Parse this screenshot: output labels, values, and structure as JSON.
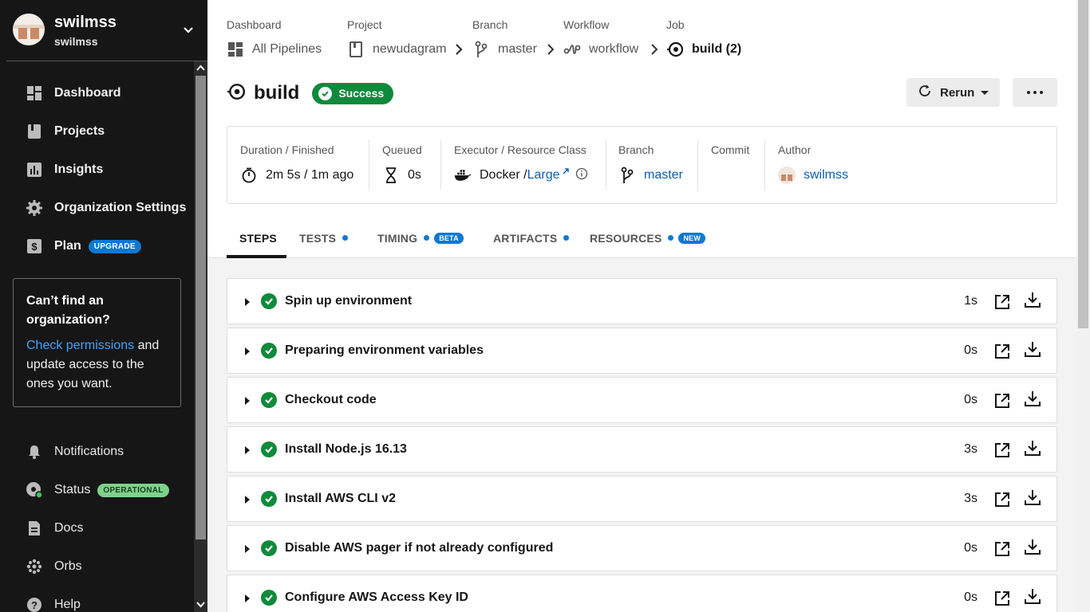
{
  "org": {
    "name": "swilmss",
    "user": "swilmss"
  },
  "nav": {
    "primary": [
      {
        "label": "Dashboard",
        "icon": "dashboard-icon"
      },
      {
        "label": "Projects",
        "icon": "projects-icon"
      },
      {
        "label": "Insights",
        "icon": "insights-icon"
      },
      {
        "label": "Organization Settings",
        "icon": "gear-icon"
      },
      {
        "label": "Plan",
        "icon": "dollar-icon",
        "badge": "UPGRADE"
      }
    ],
    "secondary": [
      {
        "label": "Notifications",
        "icon": "bell-icon"
      },
      {
        "label": "Status",
        "icon": "status-icon",
        "badge": "OPERATIONAL"
      },
      {
        "label": "Docs",
        "icon": "docs-icon"
      },
      {
        "label": "Orbs",
        "icon": "orbs-icon"
      },
      {
        "label": "Help",
        "icon": "help-icon"
      }
    ]
  },
  "org_card": {
    "title": "Can’t find an organization?",
    "link": "Check permissions",
    "text": " and update access to the ones you want."
  },
  "breadcrumbs": [
    {
      "label": "Dashboard",
      "value": "All Pipelines"
    },
    {
      "label": "Project",
      "value": "newudagram"
    },
    {
      "label": "Branch",
      "value": "master"
    },
    {
      "label": "Workflow",
      "value": "workflow"
    },
    {
      "label": "Job",
      "value": "build (2)"
    }
  ],
  "job": {
    "title": "build",
    "status": "Success"
  },
  "actions": {
    "rerun": "Rerun"
  },
  "info": {
    "duration": {
      "label": "Duration / Finished",
      "value": "2m 5s / 1m ago"
    },
    "queued": {
      "label": "Queued",
      "value": "0s"
    },
    "executor": {
      "label": "Executor / Resource Class",
      "value": "Docker / ",
      "link": "Large"
    },
    "branch": {
      "label": "Branch",
      "value": "master"
    },
    "commit": {
      "label": "Commit",
      "value": ""
    },
    "author": {
      "label": "Author",
      "value": "swilmss"
    }
  },
  "tabs": [
    {
      "label": "STEPS"
    },
    {
      "label": "TESTS"
    },
    {
      "label": "TIMING",
      "badge": "BETA"
    },
    {
      "label": "ARTIFACTS"
    },
    {
      "label": "RESOURCES",
      "badge": "NEW"
    }
  ],
  "steps": [
    {
      "name": "Spin up environment",
      "duration": "1s"
    },
    {
      "name": "Preparing environment variables",
      "duration": "0s"
    },
    {
      "name": "Checkout code",
      "duration": "0s"
    },
    {
      "name": "Install Node.js 16.13",
      "duration": "3s"
    },
    {
      "name": "Install AWS CLI v2",
      "duration": "3s"
    },
    {
      "name": "Disable AWS pager if not already configured",
      "duration": "0s"
    },
    {
      "name": "Configure AWS Access Key ID",
      "duration": "0s"
    }
  ],
  "colors": {
    "success": "#0f8a3a",
    "accent": "#0d78d1",
    "sidebar": "#161616"
  }
}
